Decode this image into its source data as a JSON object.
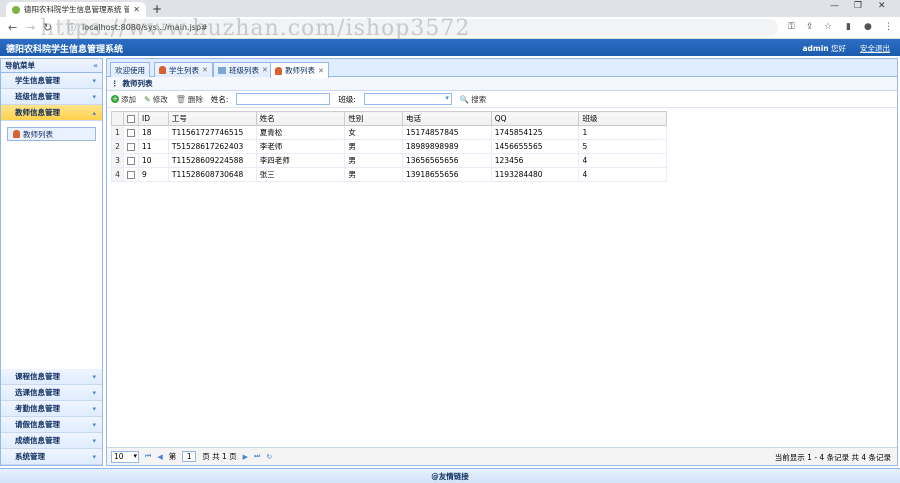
{
  "browser": {
    "tab_title": "德阳农科院学生信息管理系统 管理后台",
    "url": "localhost:8080/sys.../main.jsp#",
    "watermark": "https://www.huzhan.com/ishop3572"
  },
  "header": {
    "title": "德阳农科院学生信息管理系统",
    "user": "admin",
    "greeting": "您好",
    "logout": "安全退出"
  },
  "sidebar": {
    "title": "导航菜单",
    "top_items": [
      {
        "label": "学生信息管理"
      },
      {
        "label": "班级信息管理"
      },
      {
        "label": "教师信息管理"
      }
    ],
    "active_link": "教师列表",
    "bottom_items": [
      {
        "label": "课程信息管理"
      },
      {
        "label": "选课信息管理"
      },
      {
        "label": "考勤信息管理"
      },
      {
        "label": "请假信息管理"
      },
      {
        "label": "成绩信息管理"
      },
      {
        "label": "系统管理"
      }
    ]
  },
  "tabs": [
    {
      "label": "欢迎使用"
    },
    {
      "label": "学生列表"
    },
    {
      "label": "班级列表"
    },
    {
      "label": "教师列表"
    }
  ],
  "panel_title": "教师列表",
  "toolbar": {
    "add": "添加",
    "edit": "修改",
    "delete": "删除",
    "name_label": "姓名:",
    "class_label": "班级:",
    "search": "搜索"
  },
  "table": {
    "columns": [
      "ID",
      "工号",
      "姓名",
      "性别",
      "电话",
      "QQ",
      "班级"
    ],
    "rows": [
      {
        "n": "1",
        "id": "18",
        "no": "T11561727746515",
        "name": "夏青松",
        "sex": "女",
        "phone": "15174857845",
        "qq": "1745854125",
        "cls": "1"
      },
      {
        "n": "2",
        "id": "11",
        "no": "T51528617262403",
        "name": "李老师",
        "sex": "男",
        "phone": "18989898989",
        "qq": "1456655565",
        "cls": "5"
      },
      {
        "n": "3",
        "id": "10",
        "no": "T11528609224588",
        "name": "李四老师",
        "sex": "男",
        "phone": "13656565656",
        "qq": "123456",
        "cls": "4"
      },
      {
        "n": "4",
        "id": "9",
        "no": "T11528608730648",
        "name": "张三",
        "sex": "男",
        "phone": "13918655656",
        "qq": "1193284480",
        "cls": "4"
      }
    ]
  },
  "pager": {
    "page_size": "10",
    "page_prefix": "第",
    "page": "1",
    "page_suffix": "页 共 1 页",
    "info": "当前显示 1 - 4 条记录 共 4 条记录"
  },
  "footer": "@友情链接",
  "colors": {
    "header": "#1c5bae",
    "border": "#95b8e7",
    "active": "#ffd24c"
  }
}
